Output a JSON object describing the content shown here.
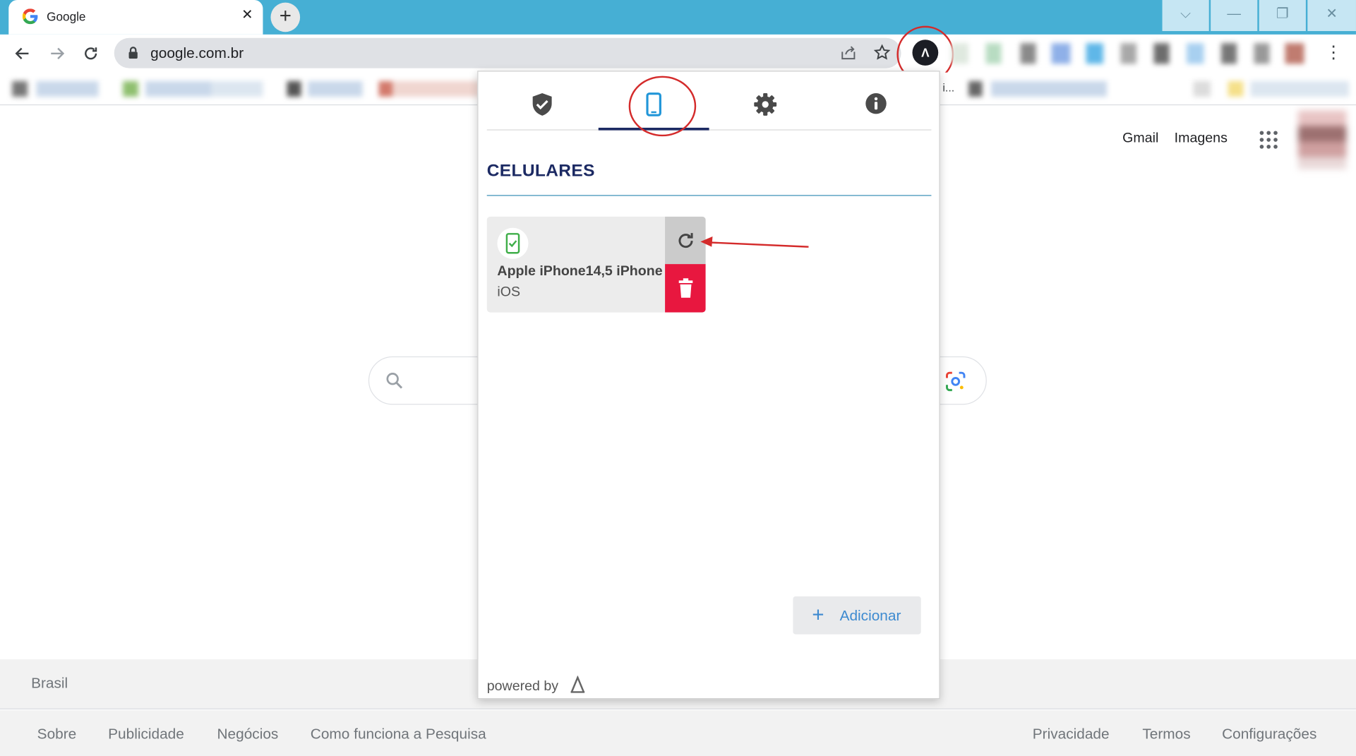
{
  "browser": {
    "tab_title": "Google",
    "tab_close": "✕",
    "new_tab": "+",
    "url": "google.com.br",
    "window_buttons": [
      "⌵",
      "—",
      "❐",
      "✕"
    ],
    "bookmark_fragment": "i..."
  },
  "google": {
    "gmail": "Gmail",
    "images": "Imagens",
    "footer_country": "Brasil",
    "footer_left": [
      "Sobre",
      "Publicidade",
      "Negócios",
      "Como funciona a Pesquisa"
    ],
    "footer_right": [
      "Privacidade",
      "Termos",
      "Configurações"
    ]
  },
  "popup": {
    "tabs": [
      "shield",
      "phone",
      "settings",
      "info"
    ],
    "active_tab": "phone",
    "section_title": "CELULARES",
    "devices": [
      {
        "name": "Apple iPhone14,5 iPhone",
        "os": "iOS"
      }
    ],
    "add_button": "Adicionar",
    "powered_by": "powered by"
  },
  "colors": {
    "tabstrip": "#46afd4",
    "brand_navy": "#1c2a63",
    "delete_red": "#e8173f",
    "add_blue": "#3d8ad0",
    "annotation_red": "#d42b2b"
  }
}
